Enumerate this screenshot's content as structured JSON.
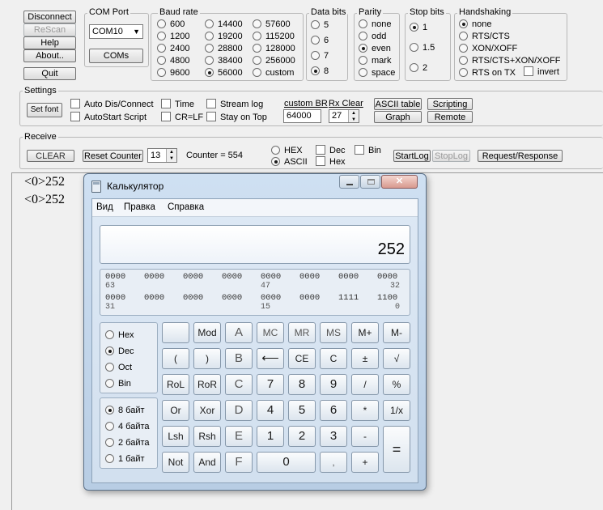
{
  "left_buttons": {
    "disconnect": "Disconnect",
    "rescan": "ReScan",
    "help": "Help",
    "about": "About..",
    "quit": "Quit"
  },
  "com_port": {
    "label": "COM Port",
    "value": "COM10",
    "coms_button": "COMs"
  },
  "baud_rate": {
    "label": "Baud rate",
    "options": [
      "600",
      "1200",
      "2400",
      "4800",
      "9600",
      "14400",
      "19200",
      "28800",
      "38400",
      "56000",
      "57600",
      "115200",
      "128000",
      "256000",
      "custom"
    ],
    "selected": "56000"
  },
  "data_bits": {
    "label": "Data bits",
    "options": [
      "5",
      "6",
      "7",
      "8"
    ],
    "selected": "8"
  },
  "parity": {
    "label": "Parity",
    "options": [
      "none",
      "odd",
      "even",
      "mark",
      "space"
    ],
    "selected": "even"
  },
  "stop_bits": {
    "label": "Stop bits",
    "options": [
      "1",
      "1.5",
      "2"
    ],
    "selected": "1"
  },
  "handshaking": {
    "label": "Handshaking",
    "options": [
      "none",
      "RTS/CTS",
      "XON/XOFF",
      "RTS/CTS+XON/XOFF",
      "RTS on TX"
    ],
    "selected": "none",
    "invert_label": "invert"
  },
  "settings": {
    "label": "Settings",
    "set_font": "Set font",
    "auto_dis_connect": "Auto Dis/Connect",
    "autostart_script": "AutoStart Script",
    "time": "Time",
    "cr_lf": "CR=LF",
    "stream_log": "Stream log",
    "stay_on_top": "Stay on Top",
    "custom_br_label": "custom BR",
    "custom_br_value": "64000",
    "rx_clear_label": "Rx Clear",
    "rx_clear_value": "27",
    "ascii_table": "ASCII table",
    "graph": "Graph",
    "scripting": "Scripting",
    "remote": "Remote"
  },
  "receive": {
    "label": "Receive",
    "clear": "CLEAR",
    "reset_counter": "Reset Counter",
    "counter_spin": "13",
    "counter_text": "Counter = 554",
    "hex": "HEX",
    "ascii": "ASCII",
    "dec": "Dec",
    "hex_chk": "Hex",
    "bin": "Bin",
    "start_log": "StartLog",
    "stop_log": "StopLog",
    "request_response": "Request/Response"
  },
  "terminal_lines": [
    "<0>252",
    "<0>252"
  ],
  "calculator": {
    "title": "Калькулятор",
    "menu": [
      "Вид",
      "Правка",
      "Справка"
    ],
    "display_value": "252",
    "bits_row1": [
      "0000",
      "0000",
      "0000",
      "0000",
      "0000",
      "0000",
      "0000",
      "0000"
    ],
    "bits_row1_pos": [
      "63",
      "47",
      "32"
    ],
    "bits_row2": [
      "0000",
      "0000",
      "0000",
      "0000",
      "0000",
      "0000",
      "1111",
      "1100"
    ],
    "bits_row2_pos": [
      "31",
      "15",
      "0"
    ],
    "number_base": [
      "Hex",
      "Dec",
      "Oct",
      "Bin"
    ],
    "number_base_selected": "Dec",
    "word_size": [
      "8 байт",
      "4 байта",
      "2 байта",
      "1 байт"
    ],
    "word_size_selected": "8 байт",
    "keys": {
      "mod": "Mod",
      "a": "A",
      "mc": "MC",
      "mr": "MR",
      "ms": "MS",
      "mplus": "M+",
      "mminus": "M-",
      "lparen": "(",
      "rparen": ")",
      "b": "B",
      "back": "⟵",
      "ce": "CE",
      "c": "C",
      "plusminus": "±",
      "sqrt": "√",
      "rol": "RoL",
      "ror": "RoR",
      "c_hex": "C",
      "seven": "7",
      "eight": "8",
      "nine": "9",
      "div": "/",
      "percent": "%",
      "or": "Or",
      "xor": "Xor",
      "d": "D",
      "four": "4",
      "five": "5",
      "six": "6",
      "mul": "*",
      "recip": "1/x",
      "lsh": "Lsh",
      "rsh": "Rsh",
      "e": "E",
      "one": "1",
      "two": "2",
      "three": "3",
      "minus": "-",
      "equals": "=",
      "not": "Not",
      "and": "And",
      "f": "F",
      "zero": "0",
      "comma": ",",
      "plus": "+"
    }
  }
}
